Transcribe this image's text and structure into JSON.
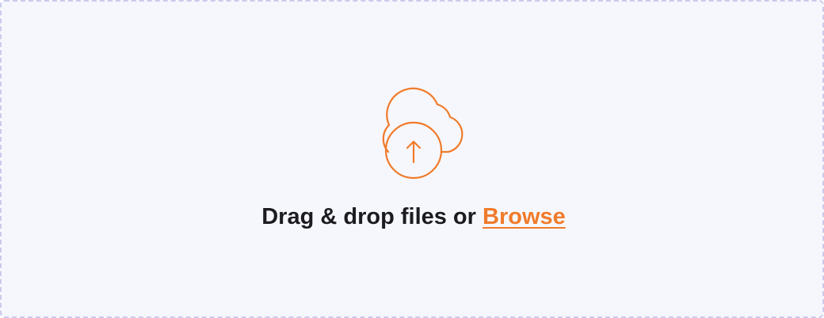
{
  "dropzone": {
    "prompt_text": "Drag & drop files or",
    "browse_label": "Browse",
    "icon": "cloud-upload-icon"
  },
  "colors": {
    "accent": "#f07b2b",
    "text": "#1c1c20",
    "background": "#f6f7fc",
    "border": "#c9cbeb"
  }
}
